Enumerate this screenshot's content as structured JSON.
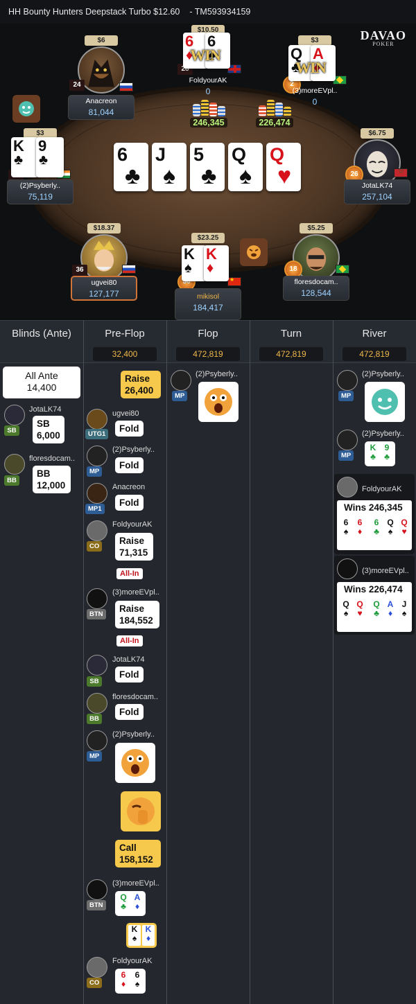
{
  "header": {
    "title": "HH  Bounty Hunters Deepstack Turbo $12.60",
    "hand_id": "- TM593934159"
  },
  "logo": {
    "line1": "DAVAO",
    "line2": "POKER"
  },
  "table": {
    "board": [
      {
        "rank": "6",
        "suit": "♣",
        "color": "blk"
      },
      {
        "rank": "J",
        "suit": "♠",
        "color": "blk"
      },
      {
        "rank": "5",
        "suit": "♣",
        "color": "blk"
      },
      {
        "rank": "Q",
        "suit": "♠",
        "color": "blk"
      },
      {
        "rank": "Q",
        "suit": "♥",
        "color": "red"
      }
    ],
    "pots": {
      "left": "246,345",
      "right": "226,474"
    },
    "win_label": "WIN",
    "seats": {
      "anacreon": {
        "bounty": "$6",
        "name": "Anacreon",
        "stack": "81,044",
        "level": "24"
      },
      "foldyourak": {
        "bounty": "$10.50",
        "name": "FoldyourAK",
        "stack": "0",
        "level": "28",
        "cards": [
          "6",
          "6"
        ]
      },
      "moreevpl": {
        "bounty": "$3",
        "name": "(3)moreEVpl..",
        "stack": "0",
        "level": "2",
        "cards": [
          "Q",
          "A"
        ]
      },
      "psyberly": {
        "bounty": "$3",
        "name": "(2)Psyberly..",
        "stack": "75,119",
        "level": "10",
        "cards": [
          "K",
          "9"
        ]
      },
      "jotalk": {
        "bounty": "$6.75",
        "name": "JotaLK74",
        "stack": "257,104",
        "level": "26"
      },
      "ugvei": {
        "bounty": "$18.37",
        "name": "ugvei80",
        "stack": "127,177",
        "level": "36"
      },
      "mikisol": {
        "bounty": "$23.25",
        "name": "mikisol",
        "stack": "184,417",
        "level": "36",
        "cards": [
          "K",
          "K"
        ]
      },
      "flores": {
        "bounty": "$5.25",
        "name": "floresdocam..",
        "stack": "128,544",
        "level": "18"
      }
    }
  },
  "history": {
    "columns": [
      {
        "title": "Blinds (Ante)",
        "pot": ""
      },
      {
        "title": "Pre-Flop",
        "pot": "32,400"
      },
      {
        "title": "Flop",
        "pot": "472,819"
      },
      {
        "title": "Turn",
        "pot": "472,819"
      },
      {
        "title": "River",
        "pot": "472,819"
      }
    ],
    "blinds": {
      "ante_label": "All Ante",
      "ante_value": "14,400",
      "sb": {
        "name": "JotaLK74",
        "pos": "SB",
        "label": "SB",
        "value": "6,000"
      },
      "bb": {
        "name": "floresdocam..",
        "pos": "BB",
        "label": "BB",
        "value": "12,000"
      }
    },
    "preflop": [
      {
        "name": "",
        "pos": "",
        "action": "Raise",
        "amount": "26,400"
      },
      {
        "name": "ugvei80",
        "pos": "UTG1",
        "action": "Fold"
      },
      {
        "name": "(2)Psyberly..",
        "pos": "MP",
        "action": "Fold"
      },
      {
        "name": "Anacreon",
        "pos": "MP1",
        "action": "Fold"
      },
      {
        "name": "FoldyourAK",
        "pos": "CO",
        "action": "Raise",
        "amount": "71,315",
        "tag": "All-In"
      },
      {
        "name": "(3)moreEVpl..",
        "pos": "BTN",
        "action": "Raise",
        "amount": "184,552",
        "tag": "All-In"
      },
      {
        "name": "JotaLK74",
        "pos": "SB",
        "action": "Fold"
      },
      {
        "name": "floresdocam..",
        "pos": "BB",
        "action": "Fold"
      },
      {
        "name": "(2)Psyberly..",
        "pos": "MP",
        "action": ""
      },
      {
        "name": "",
        "pos": "",
        "action": "Call",
        "amount": "158,152"
      },
      {
        "name": "(3)moreEVpl..",
        "pos": "BTN",
        "action": ""
      },
      {
        "name": "FoldyourAK",
        "pos": "CO",
        "action": ""
      }
    ],
    "flop": [
      {
        "name": "(2)Psyberly..",
        "pos": "MP"
      }
    ],
    "river": {
      "emote_player": {
        "name": "(2)Psyberly..",
        "pos": "MP"
      },
      "show_player": {
        "name": "(2)Psyberly..",
        "pos": "MP"
      },
      "winner1": {
        "name": "FoldyourAK",
        "label": "Wins 246,345"
      },
      "winner2": {
        "name": "(3)moreEVpl..",
        "label": "Wins 226,474"
      }
    }
  },
  "colors": {
    "bg": "#1b1d22",
    "pot_text": "#f0b84a",
    "stack_text": "#9fd3ff",
    "win_gold": "#e8c45a",
    "allin_red": "#c2121b"
  }
}
